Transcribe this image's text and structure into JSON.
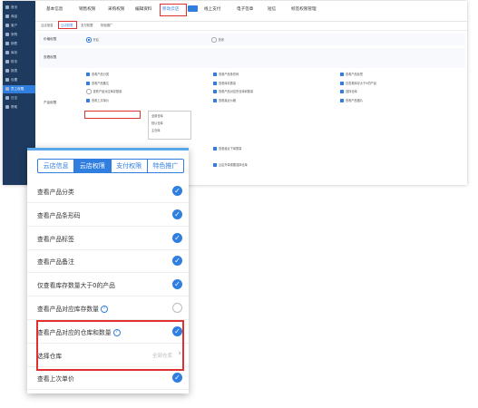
{
  "desktop": {
    "sidebar": [
      {
        "label": "首页"
      },
      {
        "label": "商品"
      },
      {
        "label": "客户"
      },
      {
        "label": "采购"
      },
      {
        "label": "销售"
      },
      {
        "label": "库存"
      },
      {
        "label": "财务"
      },
      {
        "label": "报表"
      },
      {
        "label": "设置"
      },
      {
        "label": "员工权限",
        "active": true
      },
      {
        "label": "日志"
      },
      {
        "label": "帮助"
      }
    ],
    "topnav": [
      "基本信息",
      "销售权限",
      "采购权限",
      "编辑资料",
      "移动云店",
      "线上支付",
      "电子签章",
      "短信",
      "标签权限管理"
    ],
    "topnav_active_index": 4,
    "subtabs": [
      "云店信息",
      "云店权限",
      "支付权限",
      "特色推广"
    ],
    "subtab_active_index": 1,
    "sections": {
      "s1_label": "价格权限",
      "s2_label": "查看权限",
      "s3_label": "产品权限"
    },
    "opt_top_left": "开启",
    "opt_top_right": "关闭",
    "grid": [
      "查看产品分类",
      "查看产品条形码",
      "查看产品标签",
      "查看产品备注",
      "查看库存数量",
      "仅查看库存大于0的产品",
      "查看产品对应库存数量",
      "查看产品对应的仓库和数量",
      "选择仓库",
      "查看上次单价",
      "查看最近价格",
      "查看产品图片"
    ],
    "dropdown": [
      "全部仓库",
      "默认仓库",
      "主仓库"
    ],
    "bottom_opts": [
      "查看最近下单数量",
      "云店开单需要选择仓库"
    ]
  },
  "mobile": {
    "tabs": [
      "云店信息",
      "云店权限",
      "支付权限",
      "特色推广"
    ],
    "active_tab": 1,
    "rows": [
      {
        "label": "查看产品分类",
        "checked": true
      },
      {
        "label": "查看产品条形码",
        "checked": true
      },
      {
        "label": "查看产品标签",
        "checked": true
      },
      {
        "label": "查看产品备注",
        "checked": true
      },
      {
        "label": "仅查看库存数量大于0的产品",
        "checked": true
      },
      {
        "label": "查看产品对应库存数量",
        "help": true,
        "checked": false
      },
      {
        "label": "查看产品对应的仓库和数量",
        "help": true,
        "checked": true
      },
      {
        "label": "选择仓库",
        "value": "全部仓库",
        "arrow": true
      },
      {
        "label": "查看上次单价",
        "checked": true
      }
    ],
    "help_glyph": "?",
    "check_glyph": "✓",
    "arrow_glyph": "›"
  },
  "colors": {
    "accent": "#2f7ee0",
    "highlight": "#e03030",
    "sidebar": "#1e3a5f"
  }
}
